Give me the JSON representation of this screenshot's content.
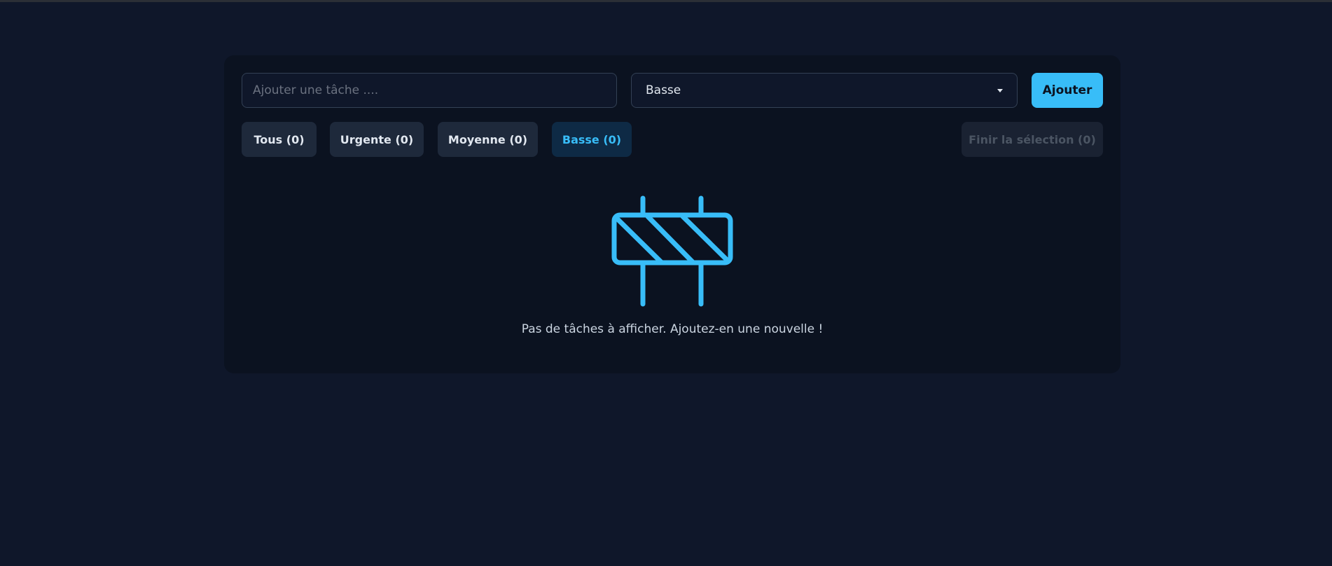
{
  "form": {
    "task_placeholder": "Ajouter une tâche ....",
    "task_value": "",
    "priority_selected": "Basse",
    "add_label": "Ajouter"
  },
  "filters": [
    {
      "label": "Tous (0)",
      "active": false
    },
    {
      "label": "Urgente (0)",
      "active": false
    },
    {
      "label": "Moyenne (0)",
      "active": false
    },
    {
      "label": "Basse (0)",
      "active": true
    }
  ],
  "finish_selection_label": "Finir la sélection (0)",
  "empty_state": {
    "icon": "barrier-icon",
    "message": "Pas de tâches à afficher. Ajoutez-en une nouvelle !"
  },
  "colors": {
    "accent": "#38bdf8",
    "background": "#0f172a",
    "card": "#0b1220"
  }
}
